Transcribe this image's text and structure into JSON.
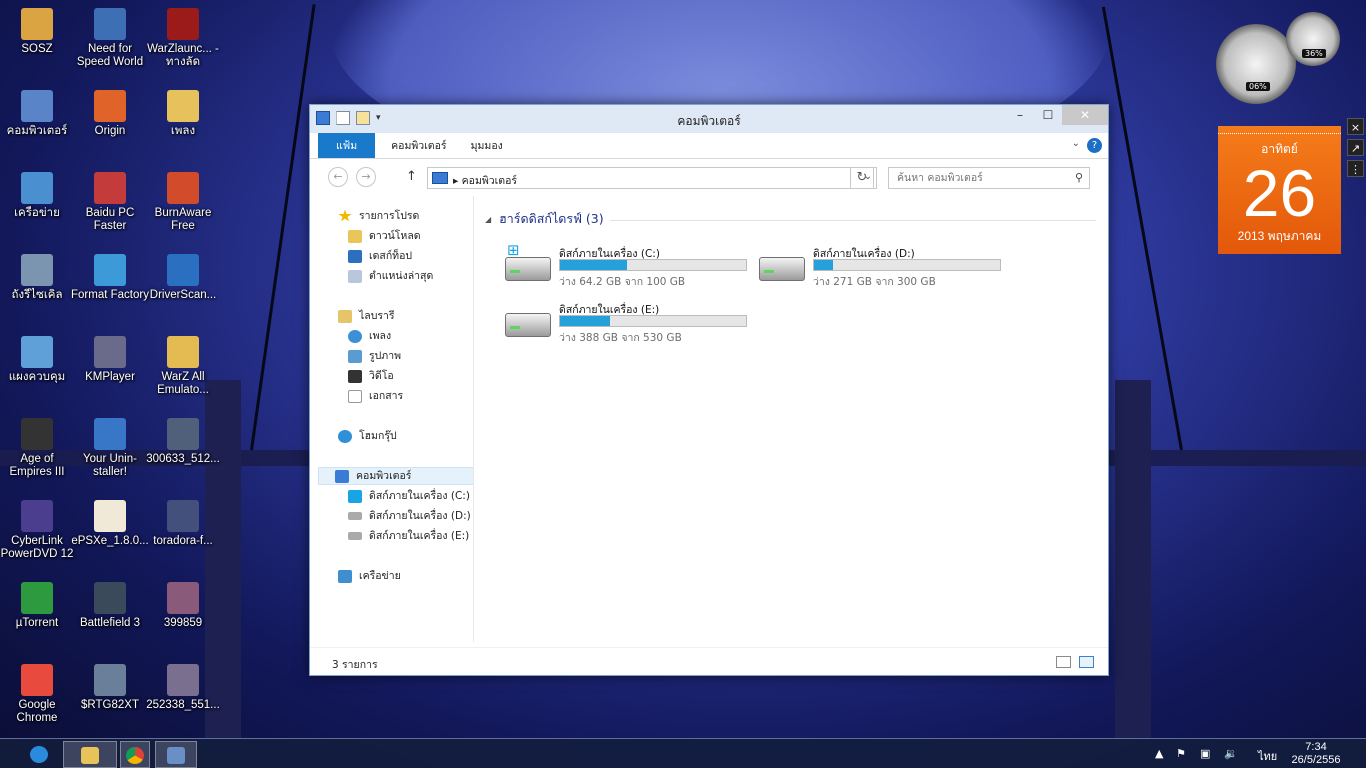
{
  "desktop": {
    "icons": [
      {
        "label": "SOSZ"
      },
      {
        "label": "Need for Speed World"
      },
      {
        "label": "WarZlaunc... - ทางลัด"
      },
      {
        "label": "คอมพิวเตอร์"
      },
      {
        "label": "Origin"
      },
      {
        "label": "เพลง"
      },
      {
        "label": "เครือข่าย"
      },
      {
        "label": "Baidu PC Faster"
      },
      {
        "label": "BurnAware Free"
      },
      {
        "label": "ถังรีไซเคิล"
      },
      {
        "label": "Format Factory"
      },
      {
        "label": "DriverScan..."
      },
      {
        "label": "แผงควบคุม"
      },
      {
        "label": "KMPlayer"
      },
      {
        "label": "WarZ All Emulato..."
      },
      {
        "label": "Age of Empires III"
      },
      {
        "label": "Your Unin-staller!"
      },
      {
        "label": "300633_512..."
      },
      {
        "label": "CyberLink PowerDVD 12"
      },
      {
        "label": "ePSXe_1.8.0..."
      },
      {
        "label": "toradora-f..."
      },
      {
        "label": "µTorrent"
      },
      {
        "label": "Battlefield 3"
      },
      {
        "label": "399859"
      },
      {
        "label": "Google Chrome"
      },
      {
        "label": "$RTG82XT"
      },
      {
        "label": "252338_551..."
      }
    ]
  },
  "gadgets": {
    "cpu_gauge": {
      "value": "06%"
    },
    "mem_gauge": {
      "value": "36%"
    },
    "calendar": {
      "weekday": "อาทิตย์",
      "day": "26",
      "month_year": "2013 พฤษภาคม"
    }
  },
  "explorer": {
    "title": "คอมพิวเตอร์",
    "ribbon_tabs": [
      "แฟ้ม",
      "คอมพิวเตอร์",
      "มุมมอง"
    ],
    "help_label": "?",
    "address": {
      "breadcrumb": "คอมพิวเตอร์"
    },
    "search": {
      "placeholder": "ค้นหา คอมพิวเตอร์"
    },
    "nav": {
      "favorites": {
        "label": "รายการโปรด",
        "items": [
          "ดาวน์โหลด",
          "เดสก์ท็อป",
          "ตำแหน่งล่าสุด"
        ]
      },
      "libraries": {
        "label": "ไลบรารี",
        "items": [
          "เพลง",
          "รูปภาพ",
          "วิดีโอ",
          "เอกสาร"
        ]
      },
      "homegroup": {
        "label": "โฮมกรุ๊ป"
      },
      "computer": {
        "label": "คอมพิวเตอร์",
        "items": [
          "ดิสก์ภายในเครื่อง (C:)",
          "ดิสก์ภายในเครื่อง (D:)",
          "ดิสก์ภายในเครื่อง (E:)"
        ]
      },
      "network": {
        "label": "เครือข่าย"
      }
    },
    "group_header": "ฮาร์ดดิสก์ไดรฟ์ (3)",
    "drives": [
      {
        "name": "ดิสก์ภายในเครื่อง (C:)",
        "free_text": "ว่าง 64.2 GB จาก 100 GB",
        "used_fraction": 0.36,
        "system": true
      },
      {
        "name": "ดิสก์ภายในเครื่อง (D:)",
        "free_text": "ว่าง 271 GB จาก 300 GB",
        "used_fraction": 0.1,
        "system": false
      },
      {
        "name": "ดิสก์ภายในเครื่อง (E:)",
        "free_text": "ว่าง 388 GB จาก 530 GB",
        "used_fraction": 0.27,
        "system": false
      }
    ],
    "status": {
      "item_count": "3 รายการ"
    }
  },
  "taskbar": {
    "language": "ไทย",
    "time": "7:34",
    "date": "26/5/2556"
  },
  "colors": {
    "accent": "#1979ca",
    "drive_bar": "#26a0da",
    "calendar": "#f26b12"
  }
}
